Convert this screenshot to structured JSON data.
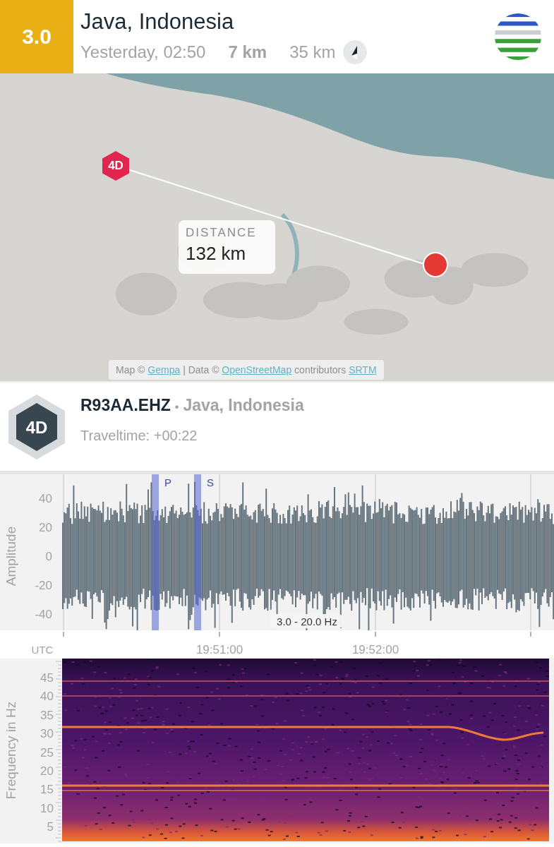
{
  "event": {
    "magnitude": "3.0",
    "region": "Java, Indonesia",
    "time": "Yesterday, 02:50",
    "depth": "7 km",
    "distance": "35 km"
  },
  "map": {
    "station_marker": "4D",
    "distance_label": "DISTANCE",
    "distance_value": "132 km",
    "attribution": [
      {
        "kind": "text",
        "text": "Map © "
      },
      {
        "kind": "link",
        "text": "Gempa"
      },
      {
        "kind": "text",
        "text": " | Data © "
      },
      {
        "kind": "link",
        "text": "OpenStreetMap"
      },
      {
        "kind": "text",
        "text": " contributors "
      },
      {
        "kind": "link",
        "text": "SRTM"
      }
    ]
  },
  "station": {
    "badge": "4D",
    "code": "R93AA.EHZ",
    "separator": "•",
    "region": "Java, Indonesia",
    "traveltime": "Traveltime: +00:22"
  },
  "waveform": {
    "ylabel": "Amplitude",
    "yticks": [
      "40",
      "20",
      "0",
      "-20",
      "-40"
    ],
    "phases": [
      {
        "label": "P"
      },
      {
        "label": "S"
      }
    ],
    "filter": "3.0 - 20.0 Hz"
  },
  "time_axis": {
    "timezone": "UTC",
    "ticks": [
      "19:51:00",
      "19:52:00"
    ]
  },
  "spectrogram": {
    "ylabel": "Frequency in Hz",
    "yticks": [
      "45",
      "40",
      "35",
      "30",
      "25",
      "20",
      "15",
      "10",
      "5"
    ]
  }
}
